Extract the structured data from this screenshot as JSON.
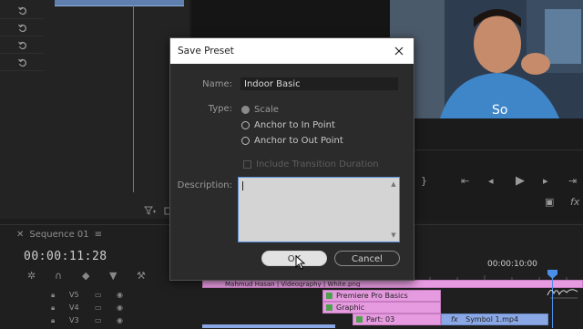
{
  "dialog": {
    "title": "Save Preset",
    "name_label": "Name:",
    "name_value": "Indoor Basic",
    "type_label": "Type:",
    "type_options": [
      "Scale",
      "Anchor to In Point",
      "Anchor to Out Point"
    ],
    "type_selected": "Scale",
    "checkbox_label": "Include Transition Duration",
    "description_label": "Description:",
    "description_value": "",
    "ok_label": "OK",
    "cancel_label": "Cancel"
  },
  "timeline": {
    "sequence_name": "Sequence 01",
    "timecode": "00:00:11:28",
    "ruler_time": "00:00:10:00",
    "tracks": [
      "V5",
      "V4",
      "V3"
    ],
    "clips": [
      {
        "label": "Mahmud Hasan | Videography | White.png"
      },
      {
        "label": "Premiere Pro Basics"
      },
      {
        "label": "Graphic"
      },
      {
        "label": "Part: 03"
      },
      {
        "label": "Symbol 1.mp4"
      }
    ]
  },
  "watermark": "Mahmud Hasan"
}
